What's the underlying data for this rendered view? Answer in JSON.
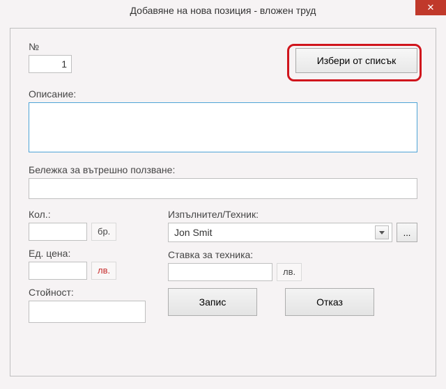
{
  "window": {
    "title": "Добавяне на нова позиция - вложен труд"
  },
  "fields": {
    "number_label": "№",
    "number_value": "1",
    "select_from_list": "Избери от списък",
    "description_label": "Описание:",
    "description_value": "",
    "note_label": "Бележка за вътрешно ползване:",
    "note_value": "",
    "qty_label": "Кол.:",
    "qty_value": "",
    "qty_unit": "бр.",
    "performer_label": "Изпълнител/Техник:",
    "performer_value": "Jon Smit",
    "dots": "...",
    "unit_price_label": "Ед. цена:",
    "unit_price_value": "",
    "currency": "лв.",
    "rate_label": "Ставка за техника:",
    "rate_value": "",
    "value_label": "Стойност:",
    "value_value": ""
  },
  "buttons": {
    "save": "Запис",
    "cancel": "Отказ"
  }
}
